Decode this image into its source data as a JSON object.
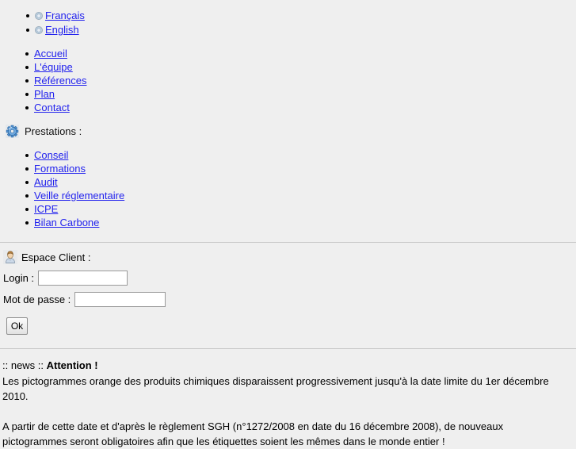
{
  "page": {
    "background_color": "#efefef",
    "link_color": "#2222ee",
    "divider_color": "#c8c8c8"
  },
  "languages": {
    "items": [
      {
        "label": "Français",
        "icon": "globe-icon"
      },
      {
        "label": "English",
        "icon": "globe-icon"
      }
    ]
  },
  "main_nav": {
    "items": [
      {
        "label": "Accueil"
      },
      {
        "label": "L'équipe"
      },
      {
        "label": "Références"
      },
      {
        "label": "Plan"
      },
      {
        "label": "Contact"
      }
    ]
  },
  "prestations": {
    "icon": "gear-icon",
    "title": "Prestations :",
    "items": [
      {
        "label": "Conseil"
      },
      {
        "label": "Formations"
      },
      {
        "label": "Audit"
      },
      {
        "label": "Veille réglementaire"
      },
      {
        "label": "ICPE"
      },
      {
        "label": "Bilan Carbone"
      }
    ]
  },
  "client_area": {
    "icon": "user-icon",
    "title": "Espace Client :",
    "login_label": "Login :",
    "login_value": "",
    "login_placeholder": "",
    "password_label": "Mot de passe :",
    "password_value": "",
    "password_placeholder": "",
    "submit_label": "Ok"
  },
  "news": {
    "tag": ":: news :: ",
    "headline": "Attention !",
    "paragraphs": [
      "Les pictogrammes orange des produits chimiques disparaissent progressivement jusqu'à la date limite du 1er décembre 2010.",
      "A partir de cette date et d'après le règlement SGH (n°1272/2008 en date du 16 décembre 2008), de nouveaux pictogrammes seront obligatoires afin que les étiquettes soient les mêmes dans le monde entier !"
    ]
  }
}
